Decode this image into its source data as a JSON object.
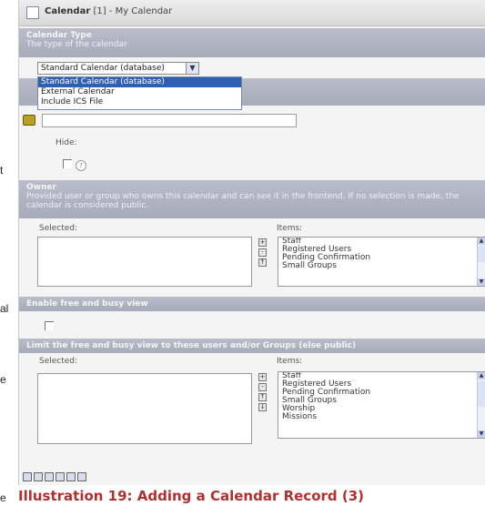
{
  "left_margin_fragments": [
    "t",
    "al",
    "e",
    "e"
  ],
  "window": {
    "title_bold": "Calendar",
    "title_rest": "[1] - My Calendar"
  },
  "calendar_type": {
    "header": "Calendar Type",
    "description": "The type of the calendar",
    "selected": "Standard Calendar (database)",
    "arrow_icon": "chevron-down-icon",
    "options": [
      "Standard Calendar (database)",
      "External Calendar",
      "Include ICS File"
    ]
  },
  "hide": {
    "label": "Hide:",
    "help_glyph": "?"
  },
  "owner": {
    "header": "Owner",
    "description": "Provided user or group who owns this calendar and can see it in the frontend. If no selection is made, the calendar is considered public.",
    "selected_label": "Selected:",
    "items_label": "Items:",
    "items": [
      "Staff",
      "Registered Users",
      "Pending Confirmation",
      "Small Groups"
    ]
  },
  "free_busy": {
    "header": "Enable free and busy view"
  },
  "limit_free_busy": {
    "header": "Limit the free and busy view to these users and/or Groups (else public)",
    "selected_label": "Selected:",
    "items_label": "Items:",
    "items": [
      "Staff",
      "Registered Users",
      "Pending Confirmation",
      "Small Groups",
      "Worship",
      "Missions"
    ]
  },
  "move_buttons": [
    "+",
    "-",
    "↑",
    "↓"
  ],
  "toolbar_icons": [
    "save-icon",
    "save-close-icon",
    "save-new-icon",
    "close-icon",
    "delete-icon",
    "undo-icon"
  ],
  "caption": "Illustration 19: Adding a Calendar Record (3)"
}
